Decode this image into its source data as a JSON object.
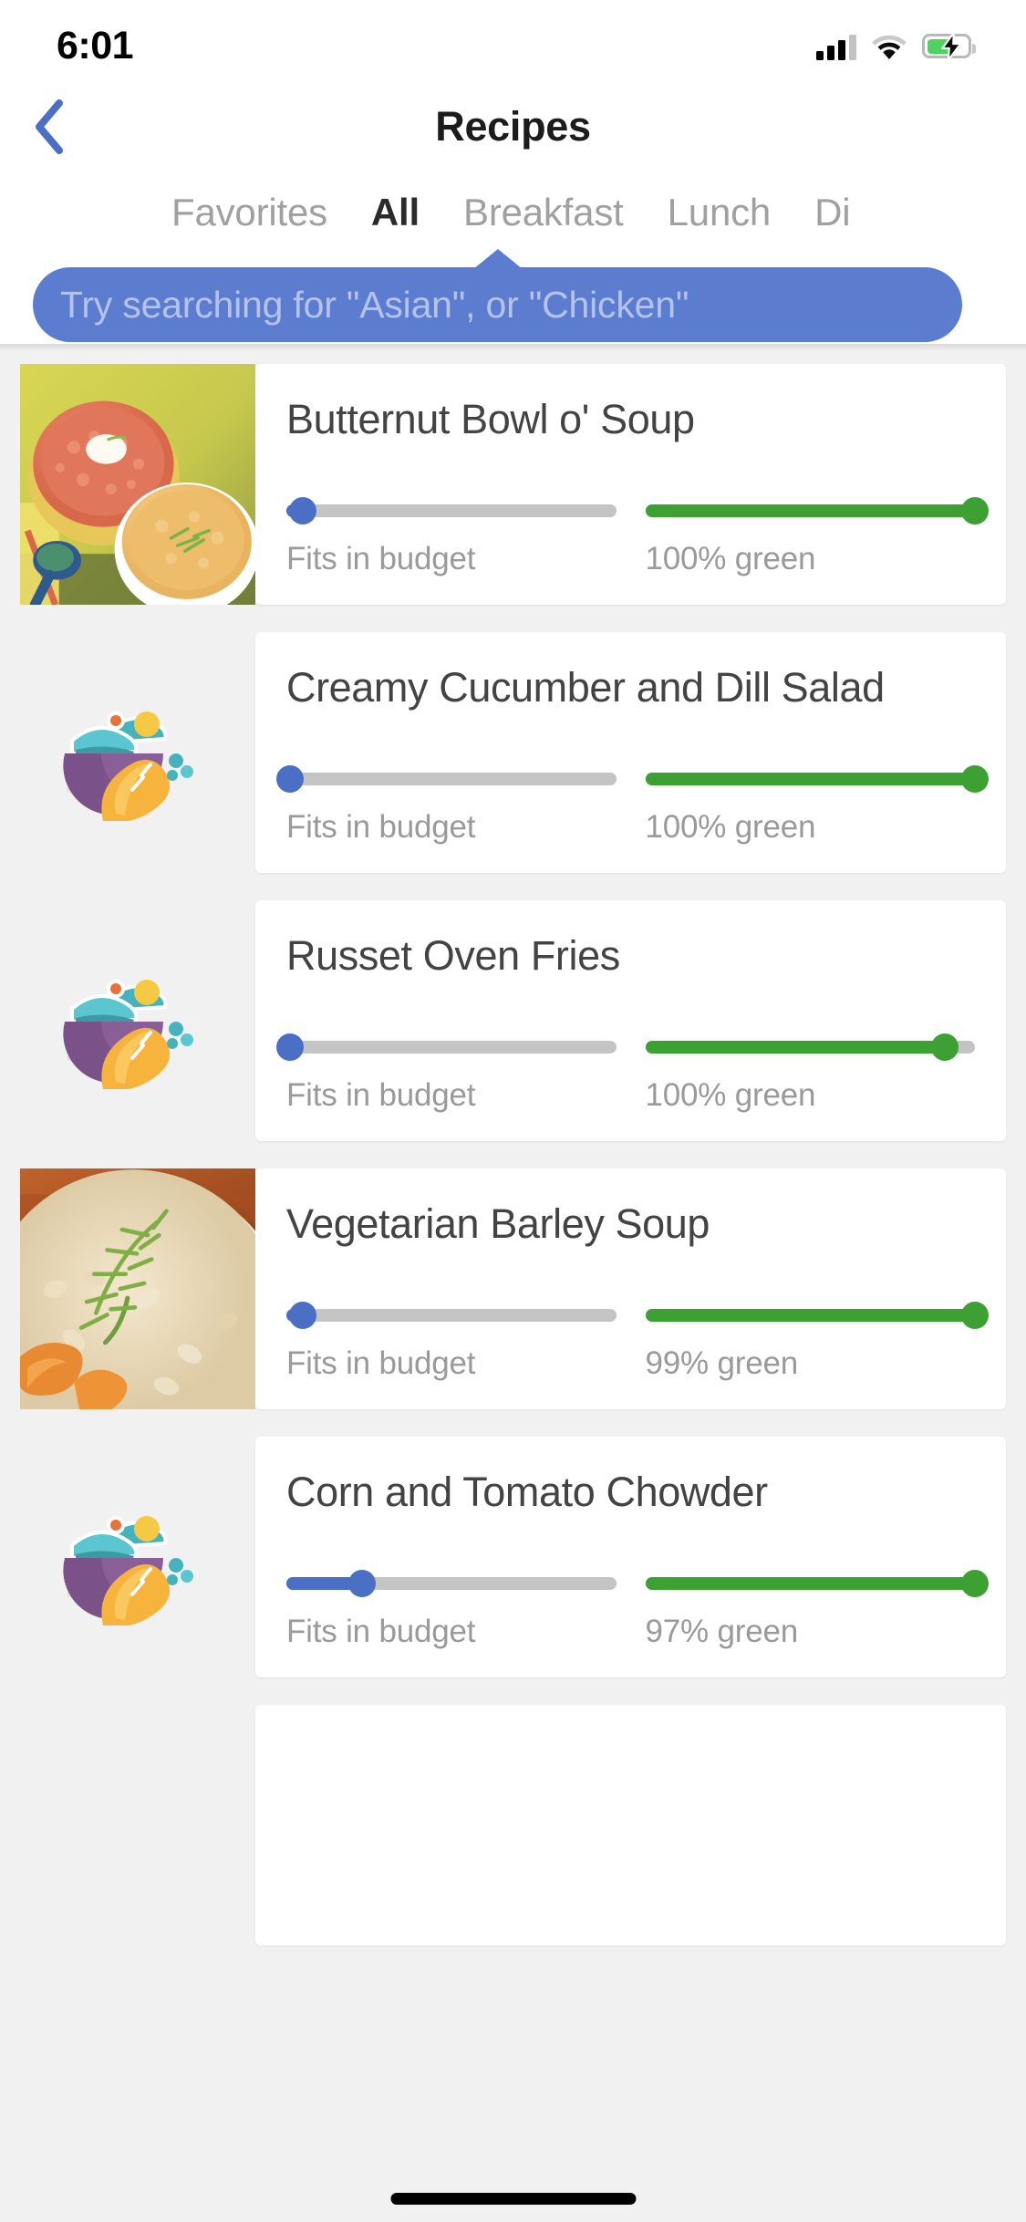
{
  "status_bar": {
    "time": "6:01",
    "signal_icon": "cellular-signal-icon",
    "signal_bars_filled": 3,
    "signal_bars_total": 4,
    "wifi_icon": "wifi-icon",
    "battery_icon": "battery-charging-icon",
    "battery_charging": true,
    "battery_fill_percent": 62
  },
  "nav": {
    "back_icon": "chevron-left-icon",
    "title": "Recipes",
    "accent_color": "#5c7cd0"
  },
  "tabs": [
    {
      "label": "Favorites",
      "active": false
    },
    {
      "label": "All",
      "active": true
    },
    {
      "label": "Breakfast",
      "active": false
    },
    {
      "label": "Lunch",
      "active": false
    },
    {
      "label": "Di",
      "active": false
    }
  ],
  "tooltip": {
    "text": "Try searching for \"Asian\", or \"Chicken\"",
    "background_color": "#5c7cd0",
    "text_color": "#b3c3ea"
  },
  "colors": {
    "budget_blue": "#4a6fc4",
    "green": "#3da033",
    "track_gray": "#c4c4c4",
    "page_background": "#f1f1f1",
    "card_background": "#ffffff"
  },
  "recipes": [
    {
      "title": "Butternut Bowl o' Soup",
      "image_type": "photo",
      "image_name": "butternut-squash-soup-photo",
      "budget": {
        "label": "Fits in budget",
        "fill_percent": 5,
        "thumb_percent": 5
      },
      "green": {
        "label": "100% green",
        "fill_percent": 100,
        "thumb_percent": 100
      }
    },
    {
      "title": "Creamy Cucumber and Dill Salad",
      "image_type": "placeholder",
      "image_name": "salad-bowl-placeholder-icon",
      "budget": {
        "label": "Fits in budget",
        "fill_percent": 1,
        "thumb_percent": 1
      },
      "green": {
        "label": "100% green",
        "fill_percent": 100,
        "thumb_percent": 100
      }
    },
    {
      "title": "Russet Oven Fries",
      "image_type": "placeholder",
      "image_name": "salad-bowl-placeholder-icon",
      "budget": {
        "label": "Fits in budget",
        "fill_percent": 1,
        "thumb_percent": 1
      },
      "green": {
        "label": "100% green",
        "fill_percent": 91,
        "thumb_percent": 91
      }
    },
    {
      "title": "Vegetarian Barley Soup",
      "image_type": "photo",
      "image_name": "barley-soup-photo",
      "budget": {
        "label": "Fits in budget",
        "fill_percent": 5,
        "thumb_percent": 5
      },
      "green": {
        "label": "99% green",
        "fill_percent": 100,
        "thumb_percent": 100
      }
    },
    {
      "title": "Corn and Tomato Chowder",
      "image_type": "placeholder",
      "image_name": "salad-bowl-placeholder-icon",
      "budget": {
        "label": "Fits in budget",
        "fill_percent": 23,
        "thumb_percent": 23
      },
      "green": {
        "label": "97% green",
        "fill_percent": 100,
        "thumb_percent": 100
      }
    }
  ],
  "home_indicator": "home-indicator"
}
